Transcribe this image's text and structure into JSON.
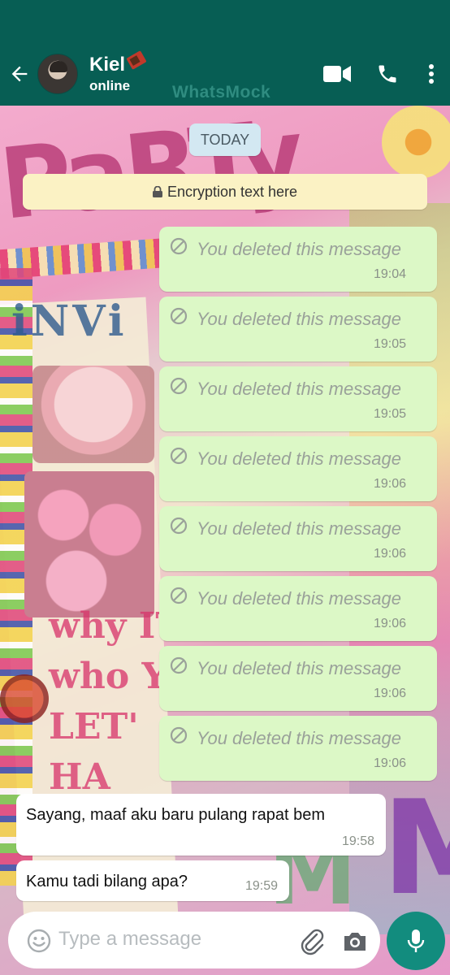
{
  "header": {
    "contact_name": "Kiel",
    "contact_status": "online",
    "watermark": "WhatsMock"
  },
  "chat": {
    "date_chip": "TODAY",
    "encryption_text": "Encryption text here",
    "outgoing": [
      {
        "text": "You deleted this message",
        "time": "19:04"
      },
      {
        "text": "You deleted this message",
        "time": "19:05"
      },
      {
        "text": "You deleted this message",
        "time": "19:05"
      },
      {
        "text": "You deleted this message",
        "time": "19:06"
      },
      {
        "text": "You deleted this message",
        "time": "19:06"
      },
      {
        "text": "You deleted this message",
        "time": "19:06"
      },
      {
        "text": "You deleted this message",
        "time": "19:06"
      },
      {
        "text": "You deleted this message",
        "time": "19:06"
      }
    ],
    "incoming": [
      {
        "text": "Sayang, maaf aku baru pulang rapat bem",
        "time": "19:58"
      },
      {
        "text": "Kamu tadi bilang apa?",
        "time": "19:59"
      }
    ]
  },
  "composer": {
    "placeholder": "Type a message"
  },
  "colors": {
    "header": "#075e54",
    "outgoing_bubble": "#dcf8c6",
    "incoming_bubble": "#ffffff",
    "mic_button": "#128c7e"
  },
  "icons": [
    "back-arrow-icon",
    "video-call-icon",
    "phone-icon",
    "more-icon",
    "blocked-icon",
    "lock-icon",
    "emoji-icon",
    "attach-icon",
    "camera-icon",
    "mic-icon"
  ]
}
